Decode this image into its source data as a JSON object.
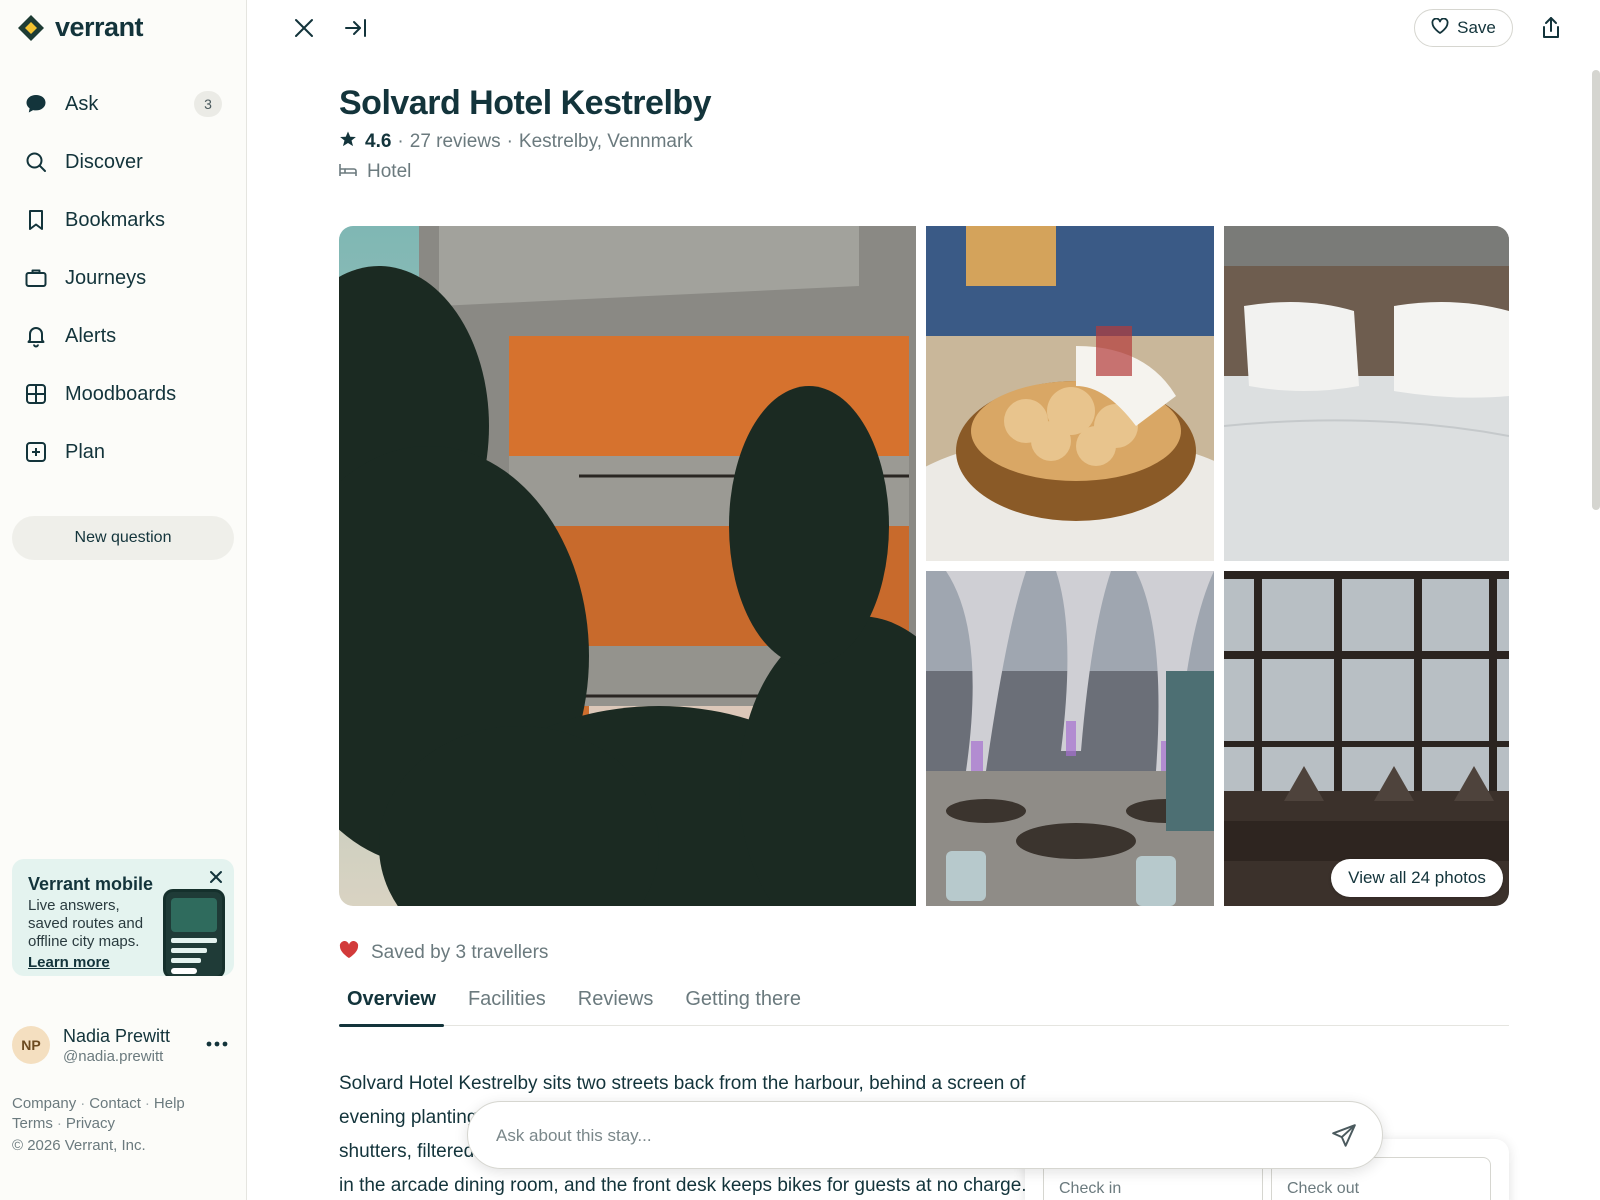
{
  "app": {
    "name": "verrant"
  },
  "sidebar": {
    "nav": [
      {
        "label": "Ask",
        "icon": "chat-bubble-icon",
        "badge": "3"
      },
      {
        "label": "Discover",
        "icon": "search-icon"
      },
      {
        "label": "Bookmarks",
        "icon": "bookmark-icon"
      },
      {
        "label": "Journeys",
        "icon": "briefcase-icon"
      },
      {
        "label": "Alerts",
        "icon": "bell-icon"
      },
      {
        "label": "Moodboards",
        "icon": "grid-icon"
      },
      {
        "label": "Plan",
        "icon": "plus-square-icon"
      }
    ],
    "new_question": "New question",
    "promo": {
      "title": "Verrant mobile",
      "text": "Live answers, saved routes and offline city maps.",
      "link": "Learn more"
    },
    "user": {
      "initials": "NP",
      "name": "Nadia Prewitt",
      "handle": "@nadia.prewitt"
    },
    "footer": {
      "links_row1": [
        "Company",
        "Contact",
        "Help"
      ],
      "links_row2": [
        "Terms",
        "Privacy"
      ],
      "copyright": "© 2026 Verrant, Inc."
    }
  },
  "header": {
    "save_label": "Save"
  },
  "place": {
    "title": "Solvard Hotel Kestrelby",
    "rating": "4.6",
    "reviews": "27 reviews",
    "location": "Kestrelby, Vennmark",
    "category": "Hotel",
    "view_all_photos": "View all 24 photos",
    "saved_by": "Saved by 3 travellers"
  },
  "tabs": [
    "Overview",
    "Facilities",
    "Reviews",
    "Getting there"
  ],
  "description": {
    "line1": "Solvard Hotel Kestrelby sits two streets back from the harbour, behind a screen of",
    "line2": "evening planting",
    "line3": "shutters, filtered",
    "line4": "in the arcade dining room, and the front desk keeps bikes for guests at no charge."
  },
  "booking": {
    "check_in": "Check in",
    "check_out": "Check out"
  },
  "ask": {
    "placeholder": "Ask about this stay..."
  },
  "colors": {
    "brand_green": "#1f7a5c",
    "brand_yellow": "#f2c230",
    "heart": "#d23a3a",
    "text": "#13343b"
  }
}
